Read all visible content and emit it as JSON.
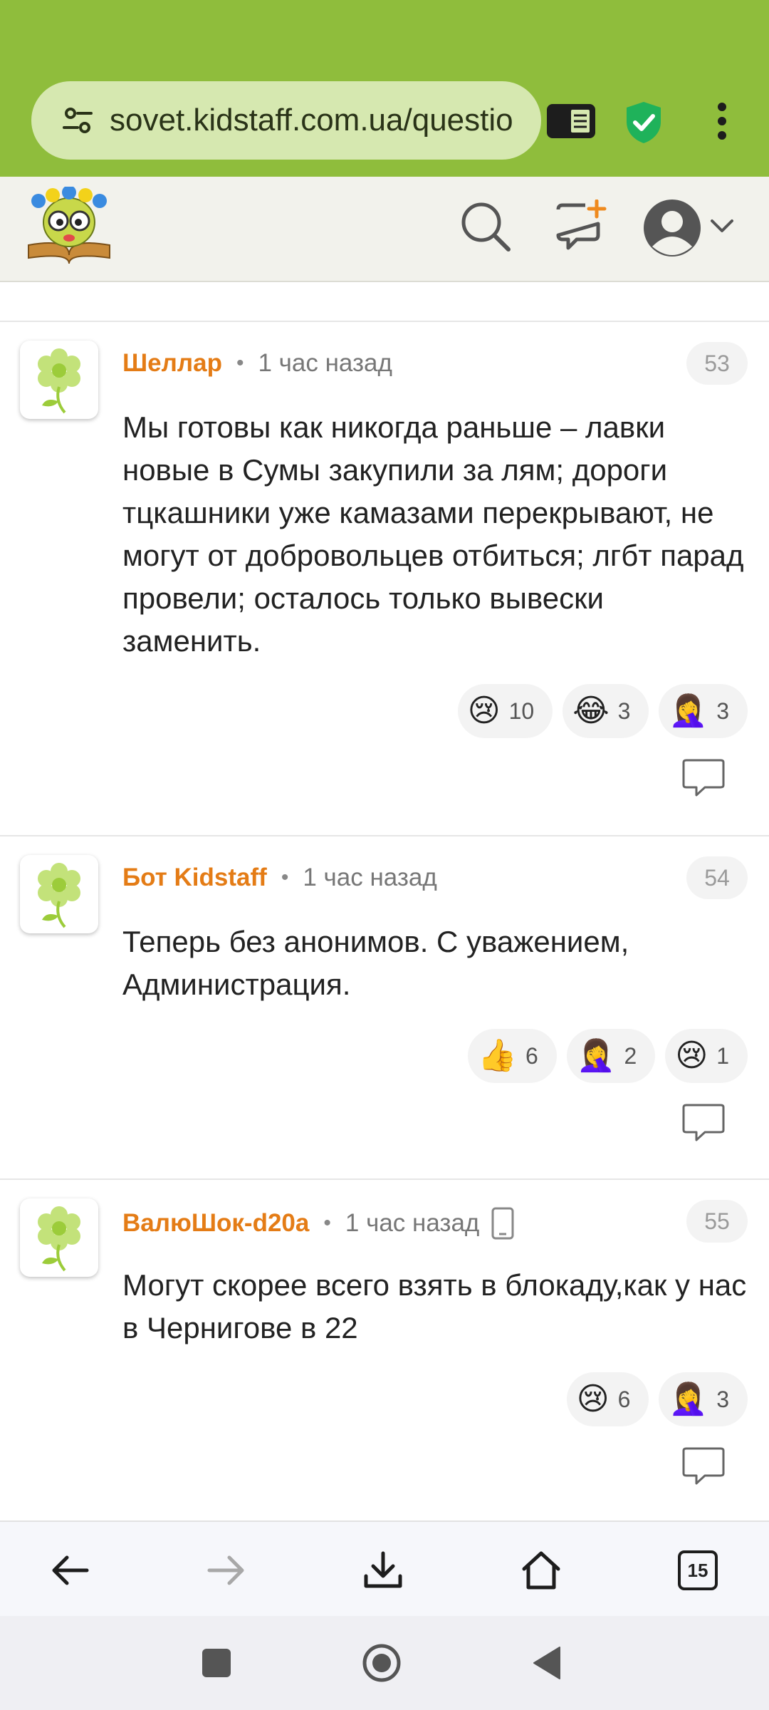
{
  "browser": {
    "url": "sovet.kidstaff.com.ua/questio",
    "tab_count": "15"
  },
  "site": {
    "logo_alt": "kidstaff logo"
  },
  "comments": [
    {
      "author": "Шеллар",
      "time": "1 час назад",
      "number": "53",
      "text": "Мы готовы как никогда раньше – лавки новые в Сумы закупили за лям; дороги тцкашники уже камазами перекрывают, не могут от добровольцев отбиться; лгбт парад провели; осталось только вывески заменить.",
      "reactions": [
        {
          "emoji": "😢",
          "count": "10"
        },
        {
          "emoji": "😂",
          "count": "3"
        },
        {
          "emoji": "🤦‍♀️",
          "count": "3"
        }
      ]
    },
    {
      "author": "Бот Kidstaff",
      "time": "1 час назад",
      "number": "54",
      "text": "Теперь без анонимов. С уважением, Администрация.",
      "reactions": [
        {
          "emoji": "👍",
          "count": "6"
        },
        {
          "emoji": "🤦‍♀️",
          "count": "2"
        },
        {
          "emoji": "😢",
          "count": "1"
        }
      ]
    },
    {
      "author": "ВалюШок-d20a",
      "time": "1 час назад",
      "number": "55",
      "text": "Могут скорее всего взять в блокаду,как у нас в Чернигове в 22",
      "reactions": [
        {
          "emoji": "😢",
          "count": "6"
        },
        {
          "emoji": "🤦‍♀️",
          "count": "3"
        }
      ]
    }
  ],
  "colors": {
    "browser_bar": "#8fbd3c",
    "author": "#e47c16"
  }
}
